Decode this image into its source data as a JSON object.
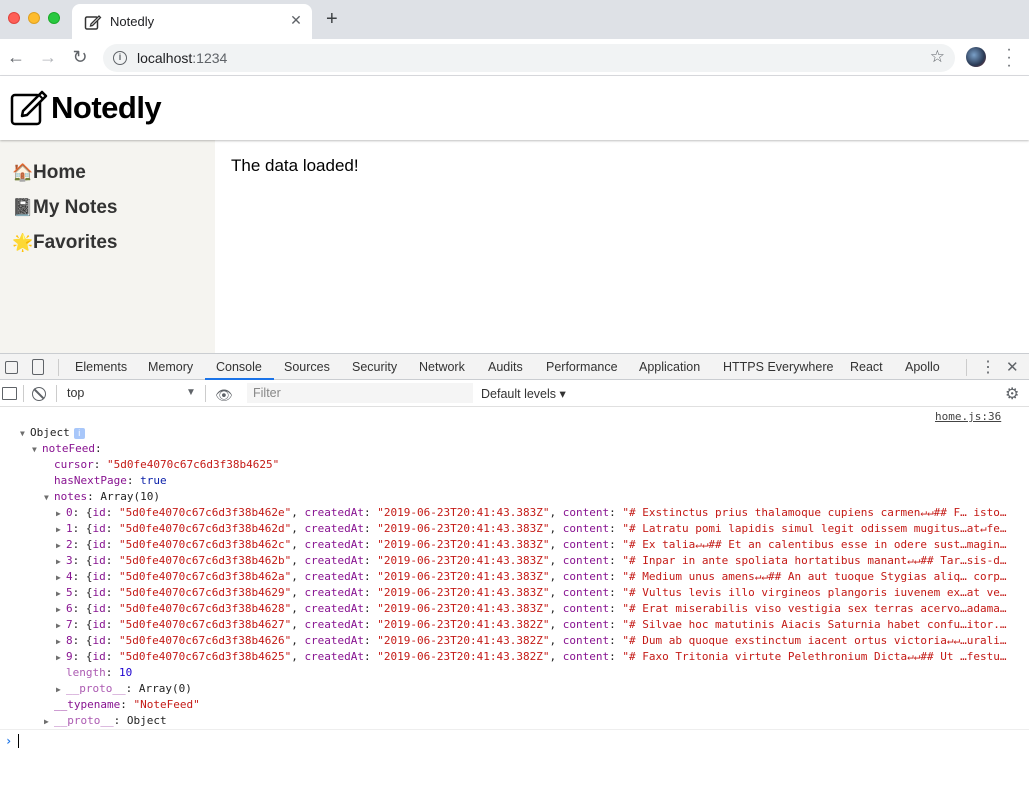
{
  "browser": {
    "tab_title": "Notedly",
    "tab_close": "✕",
    "new_tab": "+",
    "url_host": "localhost",
    "url_port": ":1234"
  },
  "app": {
    "title": "Notedly",
    "nav": [
      {
        "emoji": "🏠",
        "label": "Home"
      },
      {
        "emoji": "📓",
        "label": "My Notes"
      },
      {
        "emoji": "🌟",
        "label": "Favorites"
      }
    ],
    "content": "The data loaded!"
  },
  "devtools": {
    "tabs": [
      "Elements",
      "Memory",
      "Console",
      "Sources",
      "Security",
      "Network",
      "Audits",
      "Performance",
      "Application",
      "HTTPS Everywhere",
      "React",
      "Apollo"
    ],
    "active_tab": "Console",
    "context": "top",
    "filter_placeholder": "Filter",
    "levels": "Default levels ▾"
  },
  "console": {
    "source": "home.js:36",
    "object_label": "Object",
    "notefeed_key": "noteFeed",
    "cursor_key": "cursor",
    "cursor_value": "\"5d0fe4070c67c6d3f38b4625\"",
    "hasnext_key": "hasNextPage",
    "hasnext_value": "true",
    "notes_key": "notes",
    "notes_value": "Array(10)",
    "notes": [
      {
        "idx": "0",
        "id": "\"5d0fe4070c67c6d3f38b462e\"",
        "createdAt": "\"2019-06-23T20:41:43.383Z\"",
        "content": "\"# Exstinctus prius thalamoque cupiens carmen↵↵## F… isto…"
      },
      {
        "idx": "1",
        "id": "\"5d0fe4070c67c6d3f38b462d\"",
        "createdAt": "\"2019-06-23T20:41:43.383Z\"",
        "content": "\"# Latratu pomi lapidis simul legit odissem mugitus…at↵fe…"
      },
      {
        "idx": "2",
        "id": "\"5d0fe4070c67c6d3f38b462c\"",
        "createdAt": "\"2019-06-23T20:41:43.383Z\"",
        "content": "\"# Ex talia↵↵## Et an calentibus esse in odere sust…magin…"
      },
      {
        "idx": "3",
        "id": "\"5d0fe4070c67c6d3f38b462b\"",
        "createdAt": "\"2019-06-23T20:41:43.383Z\"",
        "content": "\"# Inpar in ante spoliata hortatibus manant↵↵## Tar…sis-d…"
      },
      {
        "idx": "4",
        "id": "\"5d0fe4070c67c6d3f38b462a\"",
        "createdAt": "\"2019-06-23T20:41:43.383Z\"",
        "content": "\"# Medium unus amens↵↵## An aut tuoque Stygias aliq… corp…"
      },
      {
        "idx": "5",
        "id": "\"5d0fe4070c67c6d3f38b4629\"",
        "createdAt": "\"2019-06-23T20:41:43.383Z\"",
        "content": "\"# Vultus levis illo virgineos plangoris iuvenem ex…at ve…"
      },
      {
        "idx": "6",
        "id": "\"5d0fe4070c67c6d3f38b4628\"",
        "createdAt": "\"2019-06-23T20:41:43.383Z\"",
        "content": "\"# Erat miserabilis viso vestigia sex terras acervo…adama…"
      },
      {
        "idx": "7",
        "id": "\"5d0fe4070c67c6d3f38b4627\"",
        "createdAt": "\"2019-06-23T20:41:43.382Z\"",
        "content": "\"# Silvae hoc matutinis Aiacis Saturnia habet confu…itor.…"
      },
      {
        "idx": "8",
        "id": "\"5d0fe4070c67c6d3f38b4626\"",
        "createdAt": "\"2019-06-23T20:41:43.382Z\"",
        "content": "\"# Dum ab quoque exstinctum iacent ortus victoria↵↵…urali…"
      },
      {
        "idx": "9",
        "id": "\"5d0fe4070c67c6d3f38b4625\"",
        "createdAt": "\"2019-06-23T20:41:43.382Z\"",
        "content": "\"# Faxo Tritonia virtute Pelethronium Dicta↵↵## Ut …festu…"
      }
    ],
    "length_key": "length",
    "length_value": "10",
    "proto_key": "__proto__",
    "proto_array": "Array(0)",
    "typename_key": "__typename",
    "typename_value": "\"NoteFeed\"",
    "proto_object": "Object"
  }
}
